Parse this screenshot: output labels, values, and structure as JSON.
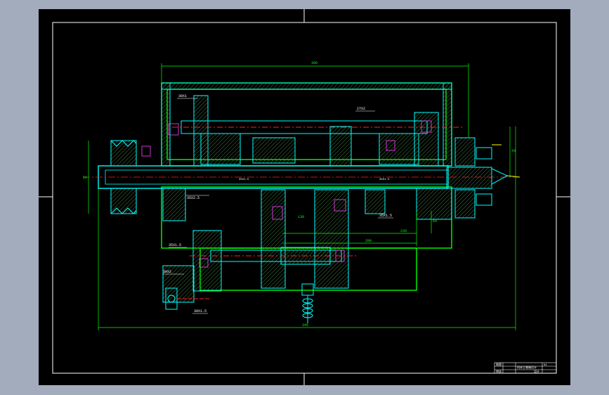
{
  "colors": {
    "background": "#a2acbd",
    "sheet": "#000000",
    "frame": "#ffffff",
    "outline": "#00ff00",
    "section": "#00ffff",
    "hatch": "#3a6a3a",
    "centerline": "#ff2020",
    "dimension": "#00ff00",
    "annotation": "#ffffff",
    "bearing": "#ff44ff",
    "accent": "#ffff00"
  },
  "dimensions": {
    "overall_length_top": "390",
    "overall_length_bottom": "345",
    "height_right": "43",
    "height_left": "56",
    "d_230": "230",
    "d_200": "200",
    "d_130": "130",
    "d_64": "64"
  },
  "annotations": {
    "note_1": "35X1.5",
    "note_2": "35X1.5",
    "note_3": "35X1.5",
    "note_4": "35X1.5",
    "note_5": "30X1",
    "note_6": "30X1.5",
    "note_7": "27X2",
    "note_8": "35X2.5",
    "note_9": "30X2"
  },
  "title_block": {
    "title": "机床主轴箱设计",
    "drawing_no": "A1",
    "school": "设计",
    "row1": "制图",
    "row2": "审核"
  }
}
